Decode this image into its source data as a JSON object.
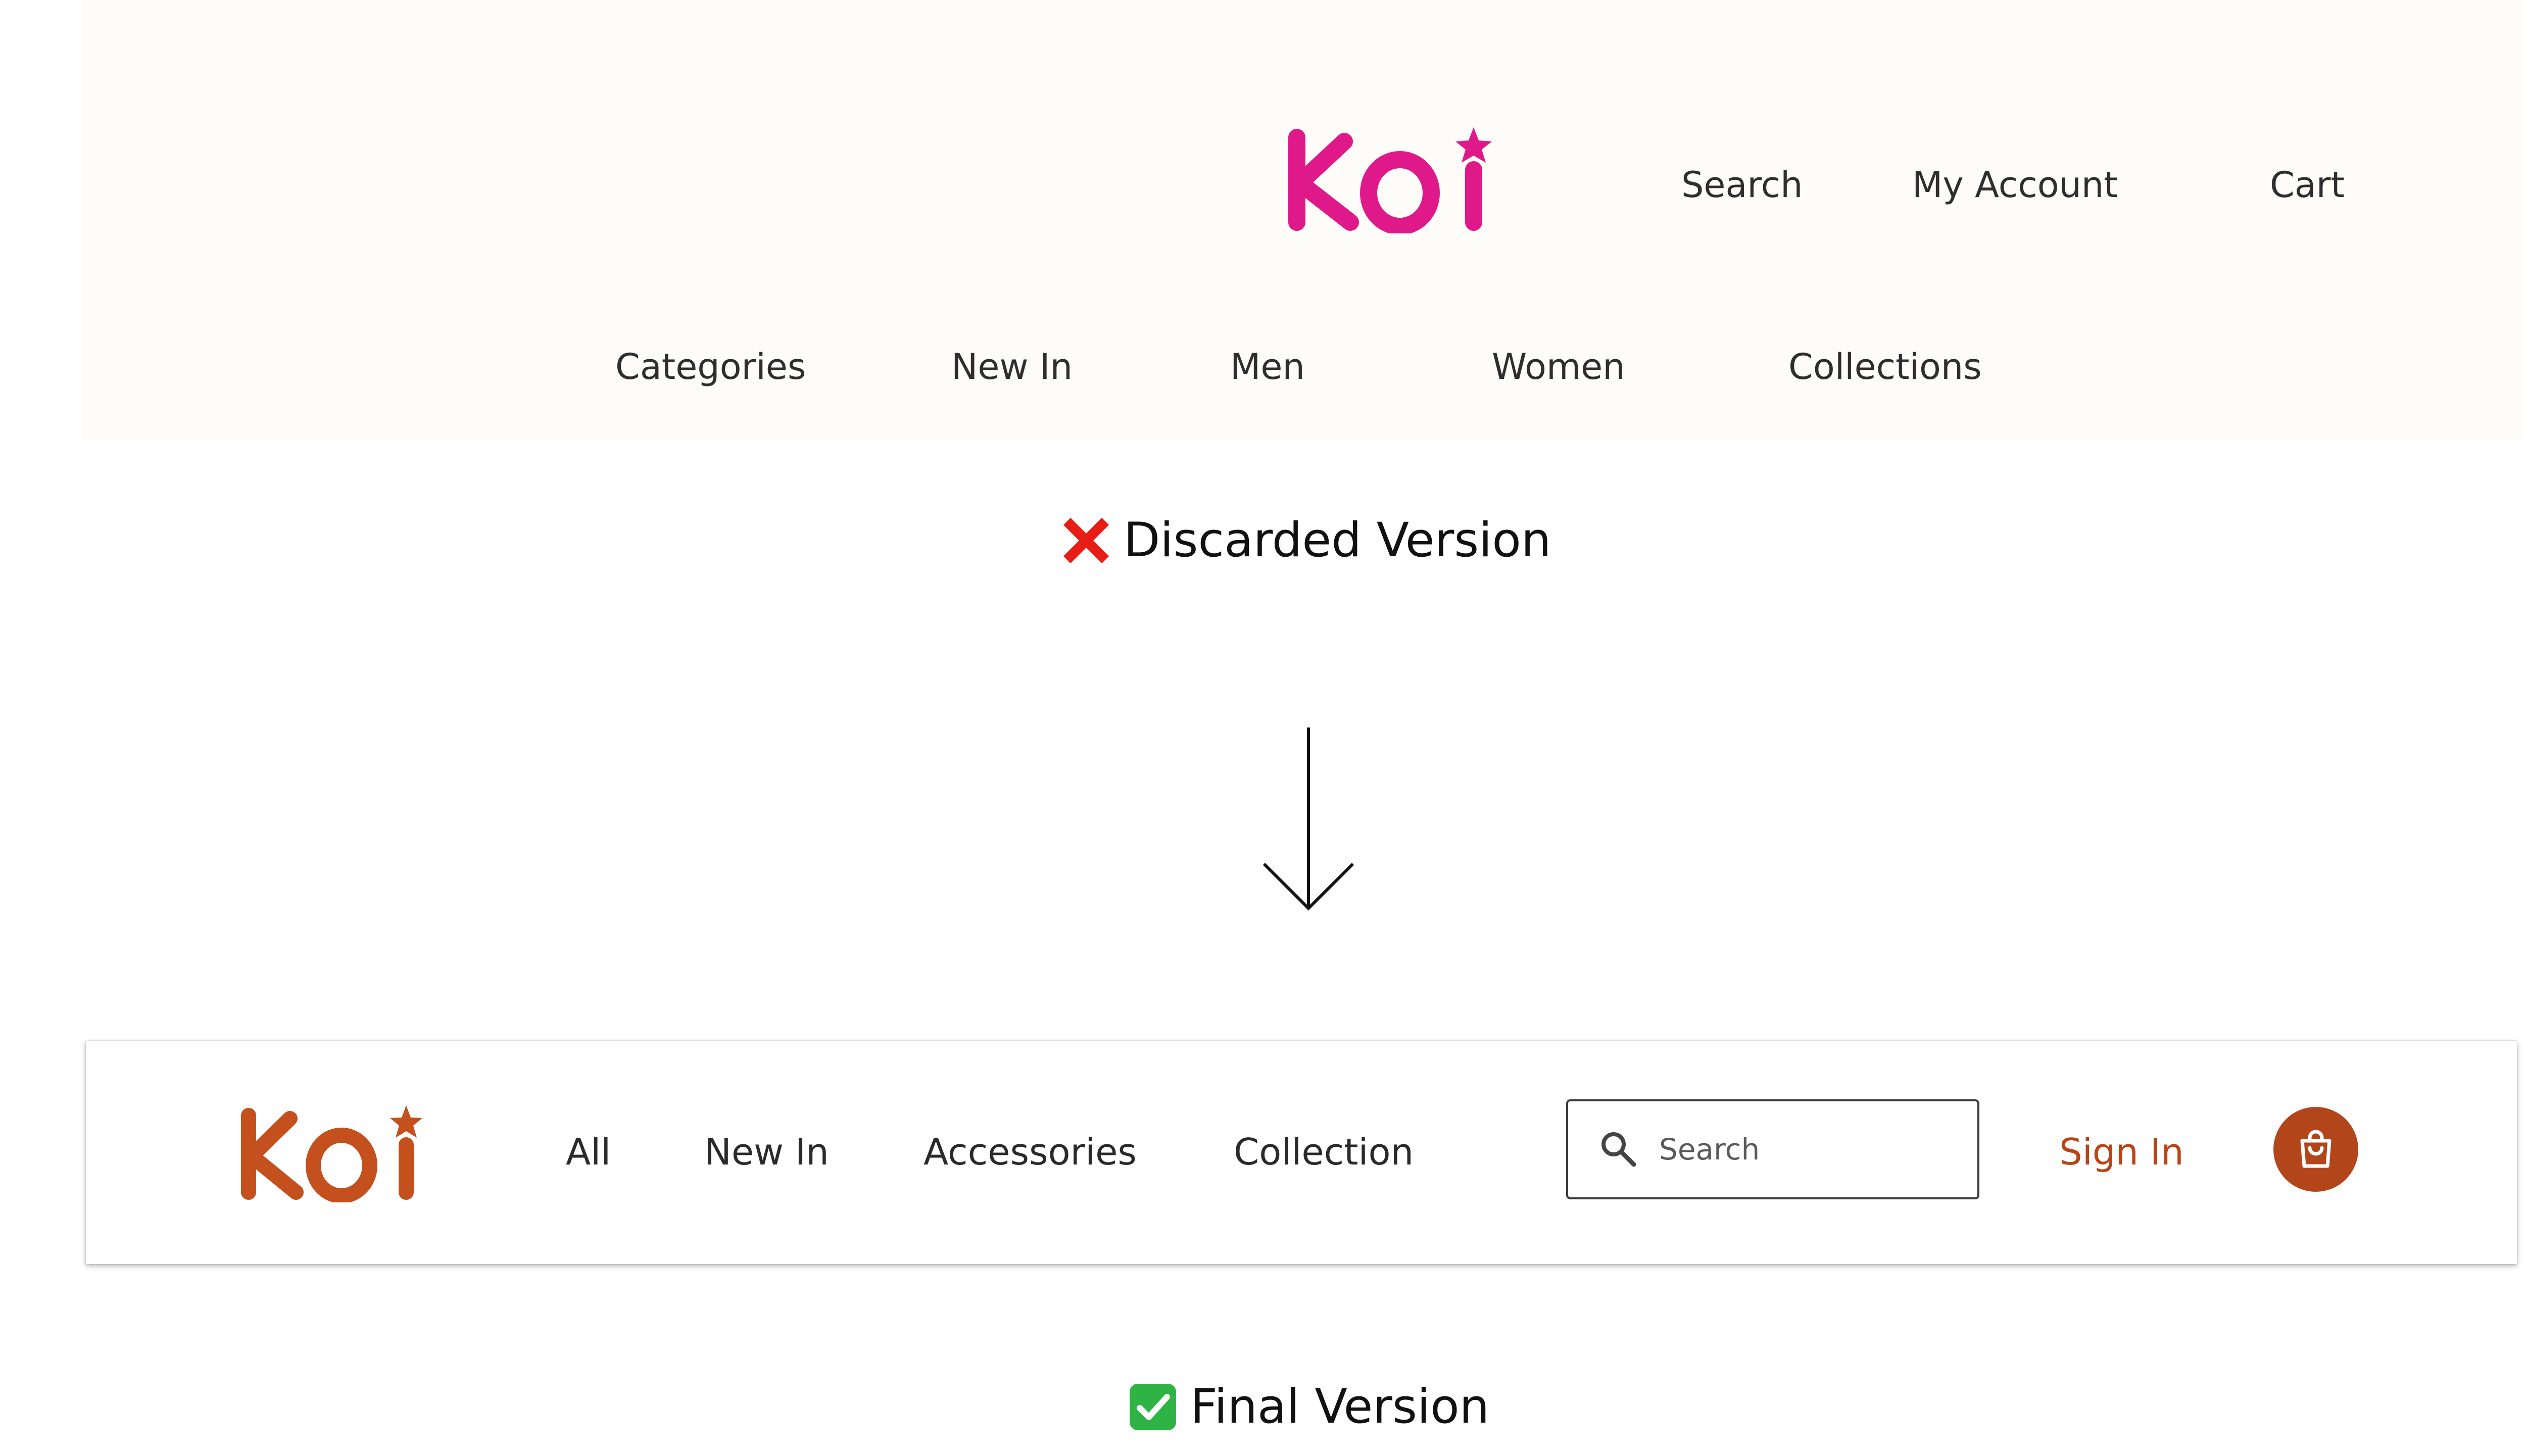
{
  "discarded": {
    "logo_text": "KOi",
    "brand_color": "#e0198b",
    "utility_links": [
      "Search",
      "My Account",
      "Cart"
    ],
    "nav_links": [
      "Categories",
      "New In",
      "Men",
      "Women",
      "Collections"
    ],
    "caption": "Discarded Version",
    "caption_icon": "cross-mark-icon"
  },
  "transition": {
    "icon": "arrow-down-icon"
  },
  "final": {
    "logo_text": "KOi",
    "brand_color": "#c4501d",
    "nav_links": [
      "All",
      "New In",
      "Accessories",
      "Collection"
    ],
    "search": {
      "placeholder": "Search",
      "icon": "search-icon"
    },
    "sign_in_label": "Sign In",
    "cart_icon": "shopping-bag-icon",
    "caption": "Final Version",
    "caption_icon": "check-mark-icon"
  }
}
